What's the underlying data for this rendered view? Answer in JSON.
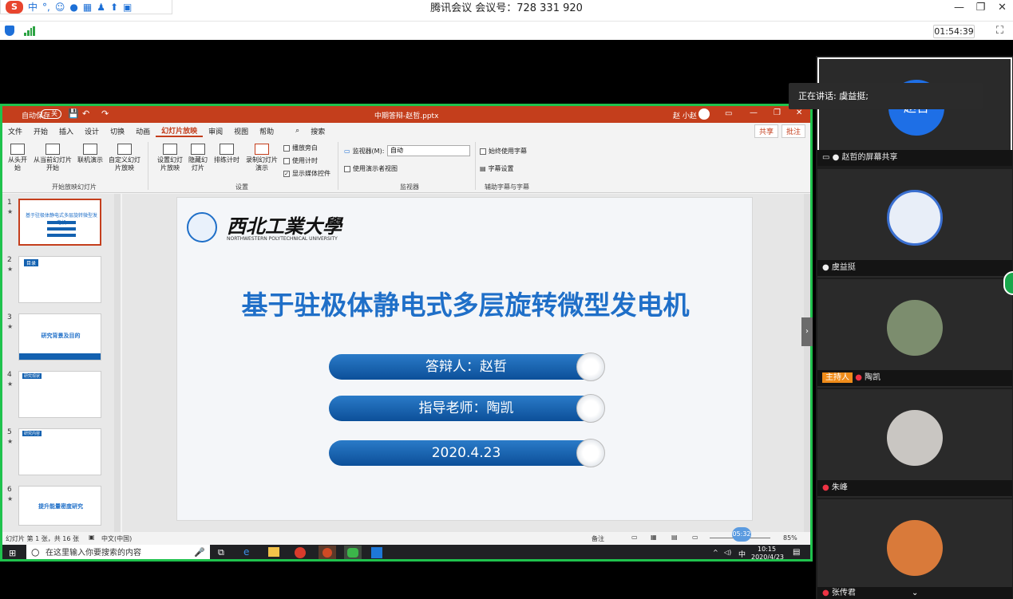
{
  "window": {
    "title": "腾讯会议 会议号：728 331 920",
    "ime": {
      "logo": "S",
      "mode": "中",
      "punct": "°,"
    },
    "timer": "01:54:39",
    "min_glyph": "—",
    "restore_glyph": "❐",
    "close_glyph": "✕"
  },
  "ppt": {
    "autosave": "自动保存",
    "autosave_state": "关",
    "filename": "中期答辩-赵哲.pptx",
    "user": "赵 小赵",
    "tabs": [
      "文件",
      "开始",
      "插入",
      "设计",
      "切换",
      "动画",
      "幻灯片放映",
      "审阅",
      "视图",
      "帮助",
      "搜索"
    ],
    "share": "共享",
    "comment": "批注",
    "ribbon": {
      "from_start": "从头开始",
      "from_current": "从当前幻灯片开始",
      "online": "联机演示",
      "custom": "自定义幻灯片放映",
      "group1": "开始放映幻灯片",
      "setup": "设置幻灯片放映",
      "hide": "隐藏幻灯片",
      "rehearse": "排练计时",
      "record": "录制幻灯片演示",
      "play_narration": "播放旁白",
      "use_timing": "使用计时",
      "show_media": "显示媒体控件",
      "group2": "设置",
      "monitor_label": "监视器(M):",
      "monitor_value": "自动",
      "presenter_view": "使用演示者视图",
      "group3": "监视器",
      "subtitles_always": "始终使用字幕",
      "subtitle_settings": "字幕设置",
      "group4": "辅助字幕与字幕"
    },
    "thumbs": [
      {
        "num": "1",
        "caption": "基于驻极体静电式多层旋转微型发电机"
      },
      {
        "num": "2",
        "caption": "目录"
      },
      {
        "num": "3",
        "caption": "研究背景及目的"
      },
      {
        "num": "4",
        "caption": "研究现状"
      },
      {
        "num": "5",
        "caption": "研究内容"
      },
      {
        "num": "6",
        "caption": "提升能量密度研究"
      }
    ],
    "slide": {
      "university_cn": "西北工業大學",
      "university_en": "NORTHWESTERN POLYTECHNICAL UNIVERSITY",
      "title": "基于驻极体静电式多层旋转微型发电机",
      "defender": "答辩人：赵哲",
      "advisor": "指导老师：陶凯",
      "date": "2020.4.23"
    },
    "status_left": "幻灯片 第 1 张，共 16 张",
    "language": "中文(中国)",
    "notes": "备注",
    "zoom": "85%",
    "time_badge": "05:32"
  },
  "taskbar": {
    "search_placeholder": "在这里输入你要搜索的内容",
    "time": "10:15",
    "date": "2020/4/23",
    "ime": "中"
  },
  "meeting": {
    "speaking_label": "正在讲话: 虞益挺;",
    "participants": [
      {
        "name": "赵哲的屏幕共享",
        "avatar_text": "赵哲"
      },
      {
        "name": "虞益挺",
        "avatar_text": ""
      },
      {
        "name": "陶凯",
        "badge": "主持人",
        "avatar_text": ""
      },
      {
        "name": "朱峰",
        "avatar_text": ""
      },
      {
        "name": "张传君",
        "avatar_text": ""
      }
    ]
  },
  "colors": {
    "ppt_red": "#c43e1c",
    "share_border": "#1fc24d",
    "pill_blue": "#1361b0",
    "title_blue": "#1f6fc8"
  }
}
